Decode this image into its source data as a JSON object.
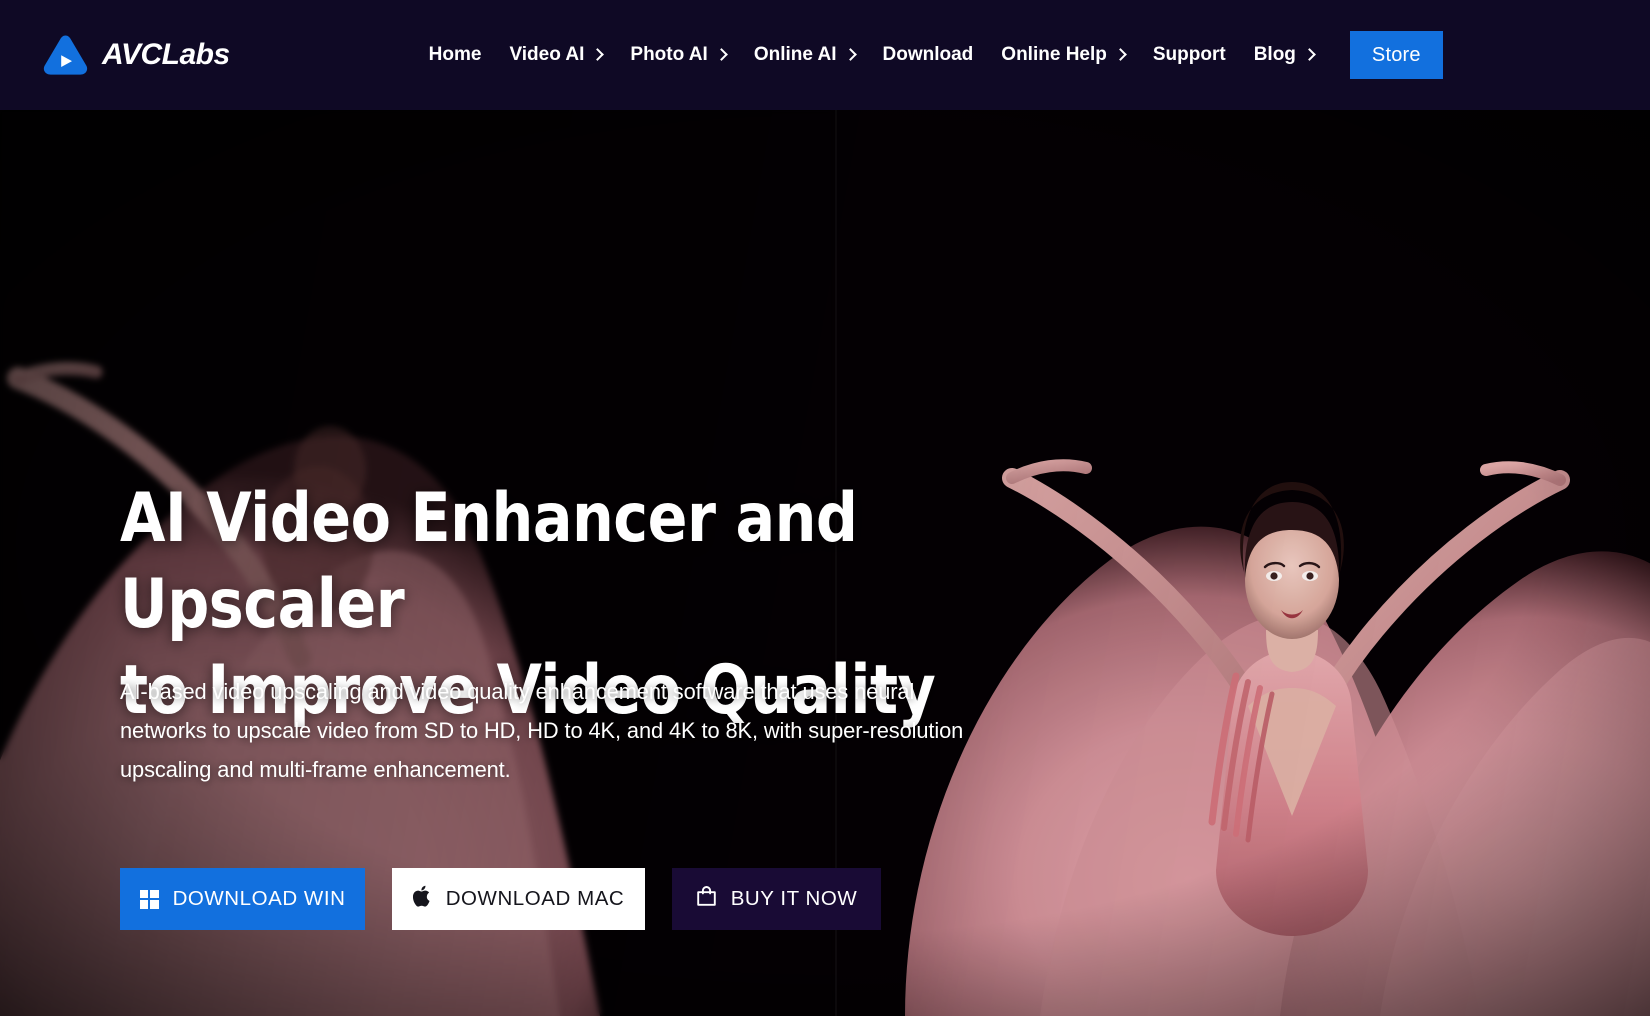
{
  "header": {
    "brand": {
      "name": "AVCLabs",
      "logo_icon": "avclabs-play-triangle-logo",
      "color": "#1270de"
    },
    "background_color": "#0f0925",
    "nav_items": [
      {
        "label": "Home",
        "has_dropdown": false
      },
      {
        "label": "Video AI",
        "has_dropdown": true
      },
      {
        "label": "Photo AI",
        "has_dropdown": true
      },
      {
        "label": "Online AI",
        "has_dropdown": true
      },
      {
        "label": "Download",
        "has_dropdown": false
      },
      {
        "label": "Online Help",
        "has_dropdown": true
      },
      {
        "label": "Support",
        "has_dropdown": false
      },
      {
        "label": "Blog",
        "has_dropdown": true
      }
    ],
    "store_button": {
      "label": "Store",
      "color": "#1270de"
    }
  },
  "hero": {
    "title_line1": "AI Video Enhancer and Upscaler",
    "title_line2": "to Improve Video Quality",
    "description": "AI-based video upscaling and video quality enhancement software that uses neural networks to upscale video from SD to HD, HD to 4K, and 4K to 8K, with super-resolution upscaling and multi-frame enhancement.",
    "buttons": [
      {
        "label": "DOWNLOAD WIN",
        "icon": "windows-icon",
        "bg": "#1270de",
        "fg": "#ffffff"
      },
      {
        "label": "DOWNLOAD MAC",
        "icon": "apple-icon",
        "bg": "#ffffff",
        "fg": "#15151c"
      },
      {
        "label": "BUY IT NOW",
        "icon": "shopping-bag-icon",
        "bg": "#190b35",
        "fg": "#ffffff"
      }
    ],
    "background_media": {
      "description": "Dancer in flowing pink gown with arms raised on black background, left half blurred and right half sharp",
      "dress_color": "#d98a95",
      "backdrop_color": "#050104"
    }
  }
}
